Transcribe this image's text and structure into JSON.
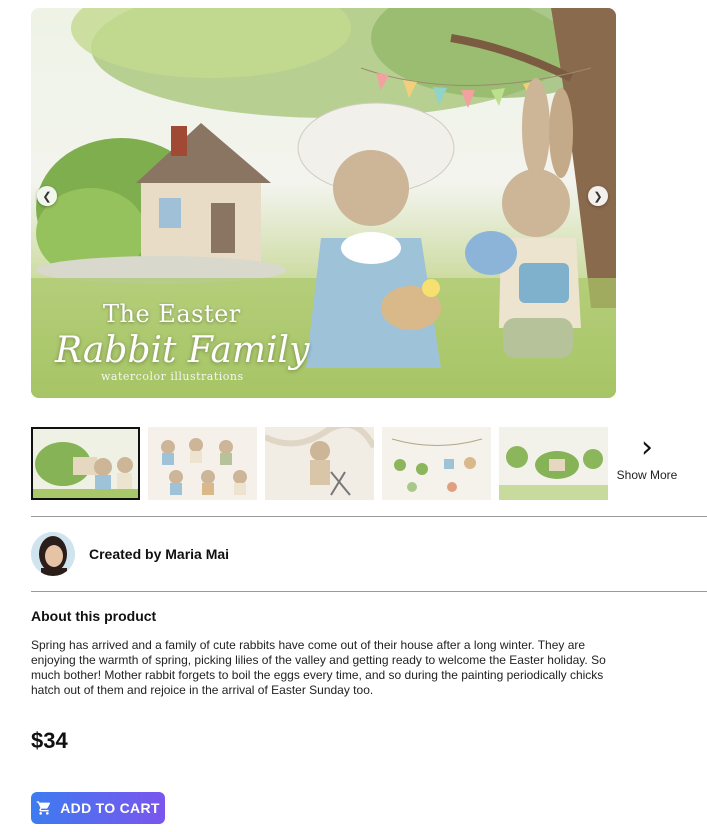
{
  "hero": {
    "title": "The Easter",
    "script": "Rabbit Family",
    "subtitle": "watercolor illustrations",
    "prev_icon": "chevron-left-icon",
    "next_icon": "chevron-right-icon"
  },
  "thumbnails": {
    "count": 5,
    "active_index": 0,
    "show_more_label": "Show More",
    "show_more_icon": "chevron-right-icon"
  },
  "creator": {
    "label": "Created by Maria Mai"
  },
  "about": {
    "heading": "About this product",
    "text": "Spring has arrived and a family of cute rabbits have come out of their house after a long winter. They are enjoying the warmth of spring, picking lilies of the valley and getting ready to welcome the Easter holiday. So much bother! Mother rabbit forgets to boil the eggs every time, and so during the painting periodically chicks hatch out of them and rejoice in the arrival of Easter Sunday too."
  },
  "price": "$34",
  "cart_button": {
    "label": "ADD TO CART",
    "icon": "cart-icon"
  },
  "colors": {
    "button_start": "#3d7bf0",
    "button_end": "#7b55ee",
    "divider": "#9a9a9a"
  }
}
